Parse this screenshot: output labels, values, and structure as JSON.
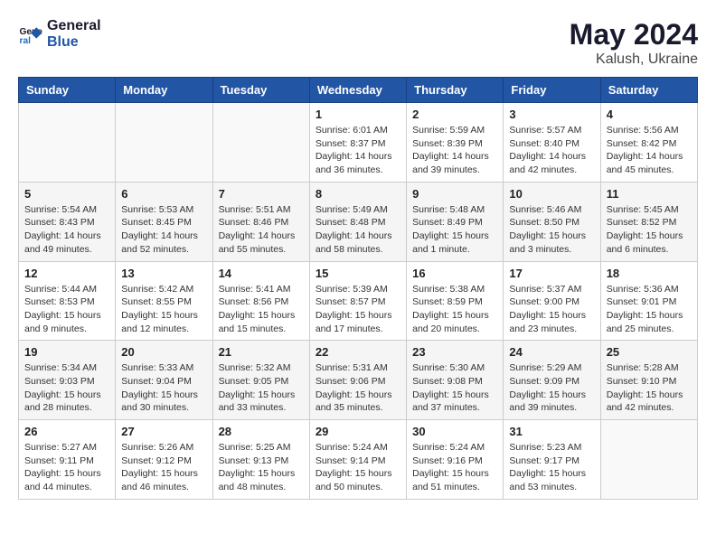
{
  "header": {
    "logo_line1": "General",
    "logo_line2": "Blue",
    "month_year": "May 2024",
    "location": "Kalush, Ukraine"
  },
  "days_of_week": [
    "Sunday",
    "Monday",
    "Tuesday",
    "Wednesday",
    "Thursday",
    "Friday",
    "Saturday"
  ],
  "weeks": [
    [
      {
        "day": "",
        "info": ""
      },
      {
        "day": "",
        "info": ""
      },
      {
        "day": "",
        "info": ""
      },
      {
        "day": "1",
        "info": "Sunrise: 6:01 AM\nSunset: 8:37 PM\nDaylight: 14 hours\nand 36 minutes."
      },
      {
        "day": "2",
        "info": "Sunrise: 5:59 AM\nSunset: 8:39 PM\nDaylight: 14 hours\nand 39 minutes."
      },
      {
        "day": "3",
        "info": "Sunrise: 5:57 AM\nSunset: 8:40 PM\nDaylight: 14 hours\nand 42 minutes."
      },
      {
        "day": "4",
        "info": "Sunrise: 5:56 AM\nSunset: 8:42 PM\nDaylight: 14 hours\nand 45 minutes."
      }
    ],
    [
      {
        "day": "5",
        "info": "Sunrise: 5:54 AM\nSunset: 8:43 PM\nDaylight: 14 hours\nand 49 minutes."
      },
      {
        "day": "6",
        "info": "Sunrise: 5:53 AM\nSunset: 8:45 PM\nDaylight: 14 hours\nand 52 minutes."
      },
      {
        "day": "7",
        "info": "Sunrise: 5:51 AM\nSunset: 8:46 PM\nDaylight: 14 hours\nand 55 minutes."
      },
      {
        "day": "8",
        "info": "Sunrise: 5:49 AM\nSunset: 8:48 PM\nDaylight: 14 hours\nand 58 minutes."
      },
      {
        "day": "9",
        "info": "Sunrise: 5:48 AM\nSunset: 8:49 PM\nDaylight: 15 hours\nand 1 minute."
      },
      {
        "day": "10",
        "info": "Sunrise: 5:46 AM\nSunset: 8:50 PM\nDaylight: 15 hours\nand 3 minutes."
      },
      {
        "day": "11",
        "info": "Sunrise: 5:45 AM\nSunset: 8:52 PM\nDaylight: 15 hours\nand 6 minutes."
      }
    ],
    [
      {
        "day": "12",
        "info": "Sunrise: 5:44 AM\nSunset: 8:53 PM\nDaylight: 15 hours\nand 9 minutes."
      },
      {
        "day": "13",
        "info": "Sunrise: 5:42 AM\nSunset: 8:55 PM\nDaylight: 15 hours\nand 12 minutes."
      },
      {
        "day": "14",
        "info": "Sunrise: 5:41 AM\nSunset: 8:56 PM\nDaylight: 15 hours\nand 15 minutes."
      },
      {
        "day": "15",
        "info": "Sunrise: 5:39 AM\nSunset: 8:57 PM\nDaylight: 15 hours\nand 17 minutes."
      },
      {
        "day": "16",
        "info": "Sunrise: 5:38 AM\nSunset: 8:59 PM\nDaylight: 15 hours\nand 20 minutes."
      },
      {
        "day": "17",
        "info": "Sunrise: 5:37 AM\nSunset: 9:00 PM\nDaylight: 15 hours\nand 23 minutes."
      },
      {
        "day": "18",
        "info": "Sunrise: 5:36 AM\nSunset: 9:01 PM\nDaylight: 15 hours\nand 25 minutes."
      }
    ],
    [
      {
        "day": "19",
        "info": "Sunrise: 5:34 AM\nSunset: 9:03 PM\nDaylight: 15 hours\nand 28 minutes."
      },
      {
        "day": "20",
        "info": "Sunrise: 5:33 AM\nSunset: 9:04 PM\nDaylight: 15 hours\nand 30 minutes."
      },
      {
        "day": "21",
        "info": "Sunrise: 5:32 AM\nSunset: 9:05 PM\nDaylight: 15 hours\nand 33 minutes."
      },
      {
        "day": "22",
        "info": "Sunrise: 5:31 AM\nSunset: 9:06 PM\nDaylight: 15 hours\nand 35 minutes."
      },
      {
        "day": "23",
        "info": "Sunrise: 5:30 AM\nSunset: 9:08 PM\nDaylight: 15 hours\nand 37 minutes."
      },
      {
        "day": "24",
        "info": "Sunrise: 5:29 AM\nSunset: 9:09 PM\nDaylight: 15 hours\nand 39 minutes."
      },
      {
        "day": "25",
        "info": "Sunrise: 5:28 AM\nSunset: 9:10 PM\nDaylight: 15 hours\nand 42 minutes."
      }
    ],
    [
      {
        "day": "26",
        "info": "Sunrise: 5:27 AM\nSunset: 9:11 PM\nDaylight: 15 hours\nand 44 minutes."
      },
      {
        "day": "27",
        "info": "Sunrise: 5:26 AM\nSunset: 9:12 PM\nDaylight: 15 hours\nand 46 minutes."
      },
      {
        "day": "28",
        "info": "Sunrise: 5:25 AM\nSunset: 9:13 PM\nDaylight: 15 hours\nand 48 minutes."
      },
      {
        "day": "29",
        "info": "Sunrise: 5:24 AM\nSunset: 9:14 PM\nDaylight: 15 hours\nand 50 minutes."
      },
      {
        "day": "30",
        "info": "Sunrise: 5:24 AM\nSunset: 9:16 PM\nDaylight: 15 hours\nand 51 minutes."
      },
      {
        "day": "31",
        "info": "Sunrise: 5:23 AM\nSunset: 9:17 PM\nDaylight: 15 hours\nand 53 minutes."
      },
      {
        "day": "",
        "info": ""
      }
    ]
  ]
}
